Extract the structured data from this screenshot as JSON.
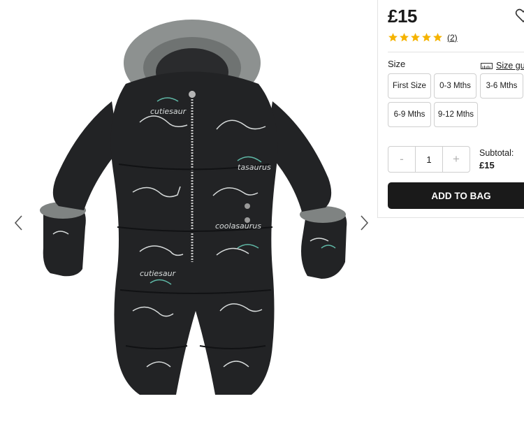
{
  "product": {
    "image_alt": "Black dinosaur print baby snowsuit with grey faux fur hood and mittens",
    "price": "£15",
    "rating": {
      "stars": 5,
      "review_count": "(2)"
    }
  },
  "colors": {
    "star": "#f5b300",
    "button_bg": "#1a1a1a",
    "border": "#cfcfcf",
    "snowsuit": "#222325",
    "fur": "#8d9190"
  },
  "size": {
    "label": "Size",
    "guide_label": "Size gu",
    "options": [
      "First Size",
      "0-3 Mths",
      "3-6 Mths",
      "6-9 Mths",
      "9-12 Mths"
    ]
  },
  "quantity": {
    "minus": "-",
    "value": "1",
    "plus": "+"
  },
  "subtotal": {
    "label": "Subtotal:",
    "value": "£15"
  },
  "add_to_bag": "ADD TO BAG",
  "icons": {
    "prev": "chevron-left-icon",
    "next": "chevron-right-icon",
    "wishlist": "heart-icon",
    "size_guide": "ruler-icon"
  }
}
